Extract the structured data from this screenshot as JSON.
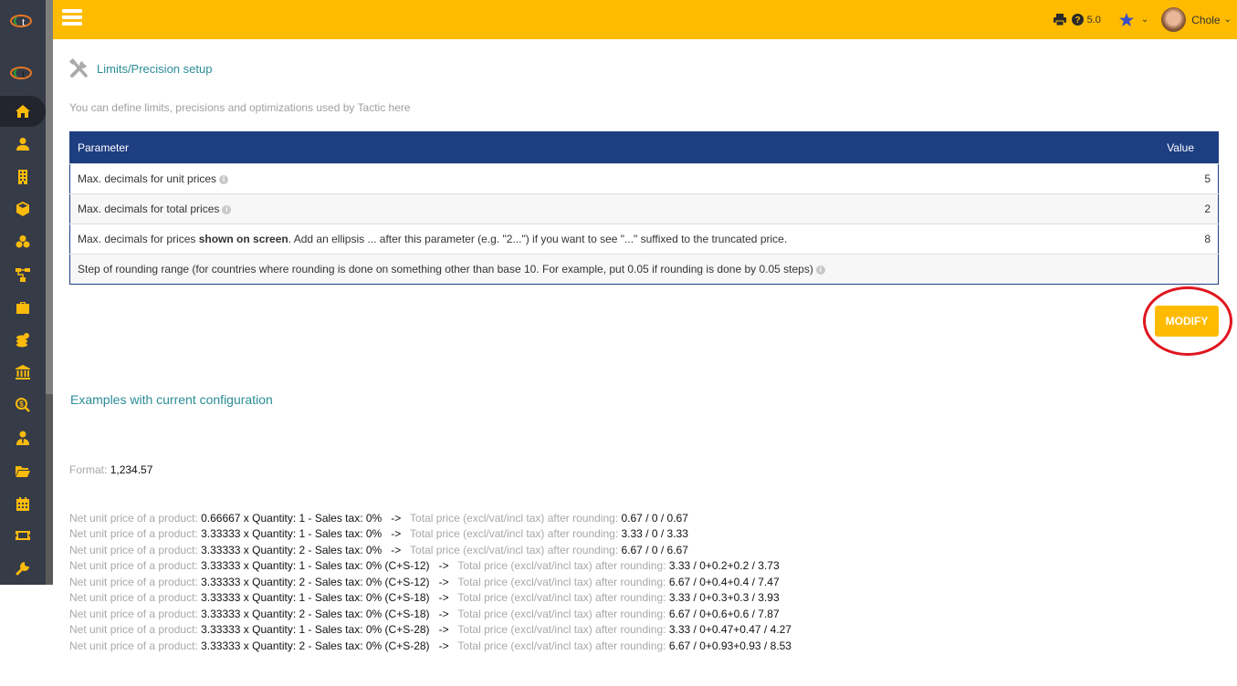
{
  "topbar": {
    "version": "5.0",
    "user_name": "Chole",
    "accent_color": "#ffbb00"
  },
  "sidebar": {
    "items": [
      {
        "icon": "home-icon",
        "active": true
      },
      {
        "icon": "user-icon"
      },
      {
        "icon": "building-icon"
      },
      {
        "icon": "cube-icon"
      },
      {
        "icon": "cubes-icon"
      },
      {
        "icon": "sitemap-icon"
      },
      {
        "icon": "briefcase-icon"
      },
      {
        "icon": "coins-icon"
      },
      {
        "icon": "bank-icon"
      },
      {
        "icon": "search-dollar-icon"
      },
      {
        "icon": "user-tie-icon"
      },
      {
        "icon": "folder-open-icon"
      },
      {
        "icon": "calendar-icon"
      },
      {
        "icon": "ticket-icon"
      },
      {
        "icon": "wrench-icon"
      }
    ]
  },
  "page": {
    "title": "Limits/Precision setup",
    "subtitle": "You can define limits, precisions and optimizations used by Tactic here"
  },
  "table": {
    "headers": {
      "parameter": "Parameter",
      "value": "Value"
    },
    "rows": [
      {
        "pre": "Max. decimals for unit prices",
        "bold": "",
        "post": "",
        "info": true,
        "value": "5"
      },
      {
        "pre": "Max. decimals for total prices",
        "bold": "",
        "post": "",
        "info": true,
        "value": "2"
      },
      {
        "pre": "Max. decimals for prices ",
        "bold": "shown on screen",
        "post": ". Add an ellipsis ... after this parameter (e.g. \"2...\") if you want to see \"...\" suffixed to the truncated price.",
        "info": false,
        "value": "8"
      },
      {
        "pre": "Step of rounding range (for countries where rounding is done on something other than base 10. For example, put 0.05 if rounding is done by 0.05 steps)",
        "bold": "",
        "post": "",
        "info": true,
        "value": ""
      }
    ]
  },
  "modify_button": "MODIFY",
  "examples": {
    "title": "Examples with current configuration",
    "format_label": "Format:",
    "format_value": "1,234.57",
    "net_label": "Net unit price of a product:",
    "arrow": "->",
    "total_label": "Total price (excl/vat/incl tax) after rounding:",
    "lines": [
      {
        "calc": "0.66667 x Quantity: 1 - Sales tax: 0%",
        "result": "0.67 / 0 / 0.67"
      },
      {
        "calc": "3.33333 x Quantity: 1 - Sales tax: 0%",
        "result": "3.33 / 0 / 3.33"
      },
      {
        "calc": "3.33333 x Quantity: 2 - Sales tax: 0%",
        "result": "6.67 / 0 / 6.67"
      },
      {
        "calc": "3.33333 x Quantity: 1 - Sales tax: 0% (C+S-12)",
        "result": "3.33 / 0+0.2+0.2 / 3.73"
      },
      {
        "calc": "3.33333 x Quantity: 2 - Sales tax: 0% (C+S-12)",
        "result": "6.67 / 0+0.4+0.4 / 7.47"
      },
      {
        "calc": "3.33333 x Quantity: 1 - Sales tax: 0% (C+S-18)",
        "result": "3.33 / 0+0.3+0.3 / 3.93"
      },
      {
        "calc": "3.33333 x Quantity: 2 - Sales tax: 0% (C+S-18)",
        "result": "6.67 / 0+0.6+0.6 / 7.87"
      },
      {
        "calc": "3.33333 x Quantity: 1 - Sales tax: 0% (C+S-28)",
        "result": "3.33 / 0+0.47+0.47 / 4.27"
      },
      {
        "calc": "3.33333 x Quantity: 2 - Sales tax: 0% (C+S-28)",
        "result": "6.67 / 0+0.93+0.93 / 8.53"
      }
    ]
  }
}
